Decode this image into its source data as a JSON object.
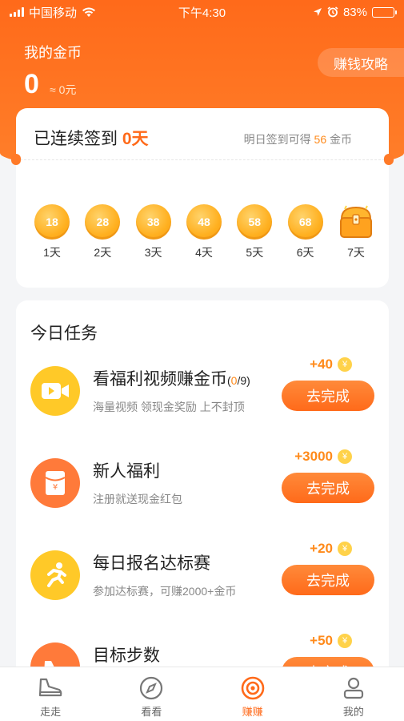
{
  "status_bar": {
    "carrier": "中国移动",
    "time": "下午4:30",
    "battery": "83%",
    "battery_level": 0.83
  },
  "header": {
    "title": "我的金币",
    "coins": "0",
    "yuan": "≈ 0元",
    "strategy_label": "赚钱攻略"
  },
  "checkin": {
    "title_prefix": "已连续签到",
    "days": "0天",
    "tomorrow_prefix": "明日签到可得",
    "tomorrow_coins": "56",
    "tomorrow_suffix": "金币",
    "days_list": [
      {
        "coins": "18",
        "label": "1天"
      },
      {
        "coins": "28",
        "label": "2天"
      },
      {
        "coins": "38",
        "label": "3天"
      },
      {
        "coins": "48",
        "label": "4天"
      },
      {
        "coins": "58",
        "label": "5天"
      },
      {
        "coins": "68",
        "label": "6天"
      },
      {
        "coins": "",
        "label": "7天",
        "icon": "treasure-chest-icon"
      }
    ]
  },
  "tasks": {
    "title": "今日任务",
    "items": [
      {
        "name": "看福利视频赚金币",
        "progress_open": "(",
        "progress_current": "0",
        "progress_total": "/9)",
        "desc": "海量视频 领现金奖励 上不封顶",
        "reward": "+40",
        "button": "去完成",
        "icon": "video-camera-icon",
        "icon_color": "#ffc928"
      },
      {
        "name": "新人福利",
        "desc": "注册就送现金红包",
        "reward": "+3000",
        "button": "去完成",
        "icon": "red-envelope-icon",
        "icon_color": "#ff7a3a"
      },
      {
        "name": "每日报名达标赛",
        "desc": "参加达标赛，可赚2000+金币",
        "reward": "+20",
        "button": "去完成",
        "icon": "running-person-icon",
        "icon_color": "#ffc928"
      },
      {
        "name": "目标步数",
        "desc": "",
        "reward": "+50",
        "button": "去完成",
        "icon": "shoe-icon",
        "icon_color": "#ff7a3a"
      }
    ],
    "yen_symbol": "¥"
  },
  "tabbar": {
    "tabs": [
      {
        "label": "走走",
        "icon": "sneaker-icon",
        "active": false
      },
      {
        "label": "看看",
        "icon": "compass-icon",
        "active": false
      },
      {
        "label": "赚赚",
        "icon": "target-icon",
        "active": true
      },
      {
        "label": "我的",
        "icon": "user-icon",
        "active": false
      }
    ]
  },
  "colors": {
    "brand": "#ff6a1a",
    "gold": "#ffb020",
    "muted": "#888888"
  }
}
